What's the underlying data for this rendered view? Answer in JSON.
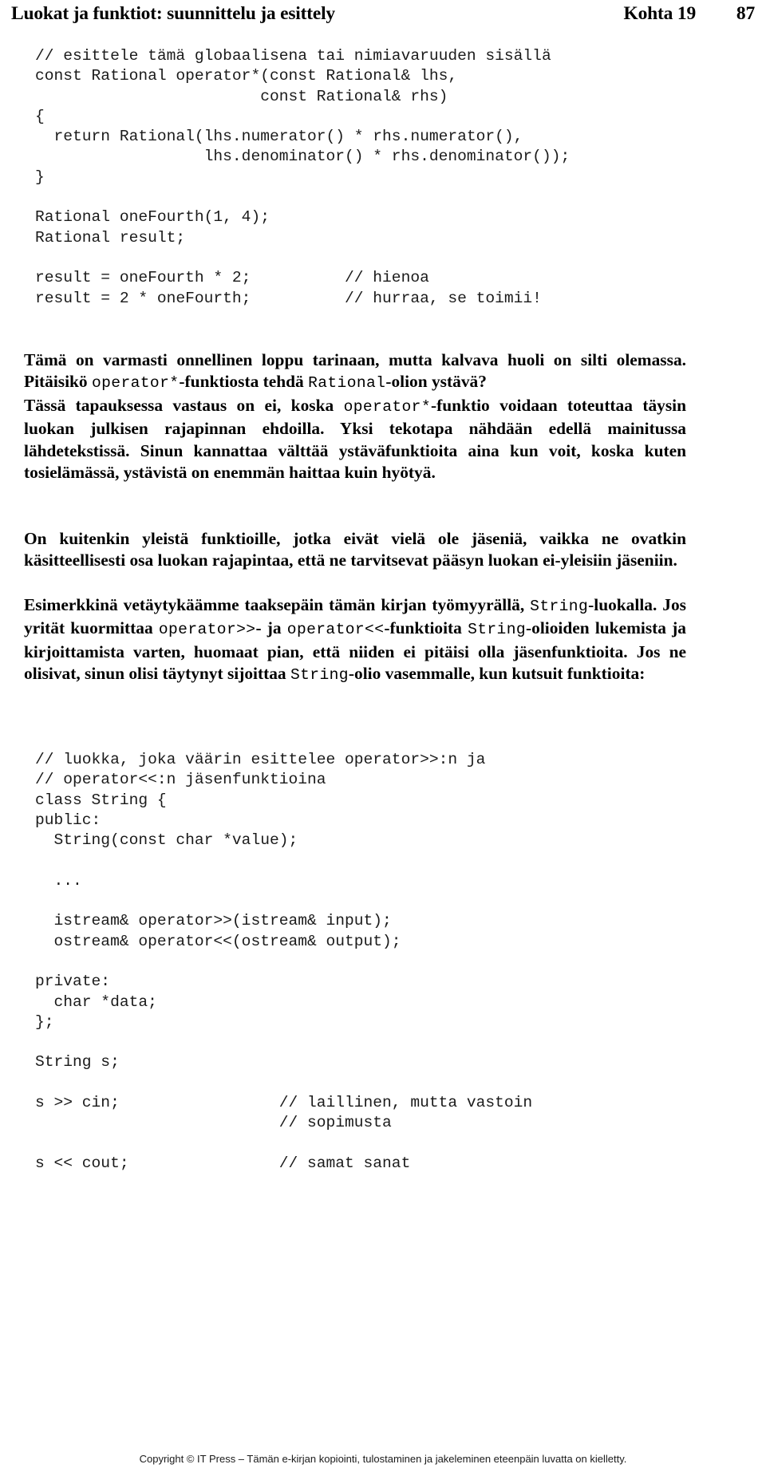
{
  "header": {
    "title": "Luokat ja funktiot: suunnittelu ja esittely",
    "section": "Kohta 19",
    "page_number": "87"
  },
  "code_block_1": {
    "lines": [
      "// esittele tämä globaalisena tai nimiavaruuden sisällä",
      "const Rational operator*(const Rational& lhs,",
      "                        const Rational& rhs)",
      "{",
      "  return Rational(lhs.numerator() * rhs.numerator(),",
      "                  lhs.denominator() * rhs.denominator());",
      "}",
      "",
      "Rational oneFourth(1, 4);",
      "Rational result;",
      "",
      "result = oneFourth * 2;          // hienoa",
      "result = 2 * oneFourth;          // hurraa, se toimii!"
    ]
  },
  "paragraphs": [
    {
      "id": "p1",
      "runs": [
        {
          "type": "text",
          "value": "Tämä on varmasti onnellinen loppu tarinaan, mutta kalvava huoli on silti olemassa. Pitäisikö "
        },
        {
          "type": "mono",
          "value": "operator*"
        },
        {
          "type": "text",
          "value": "-funktiosta tehdä "
        },
        {
          "type": "mono",
          "value": "Rational"
        },
        {
          "type": "text",
          "value": "-olion ystävä?"
        }
      ]
    },
    {
      "id": "p2",
      "runs": [
        {
          "type": "text",
          "value": "Tässä tapauksessa vastaus on ei, koska "
        },
        {
          "type": "mono",
          "value": "operator*"
        },
        {
          "type": "text",
          "value": "-funktio voidaan toteuttaa täysin luokan julkisen rajapinnan ehdoilla. Yksi tekotapa nähdään edellä mainitussa lähdetekstissä. Sinun kannattaa välttää ystäväfunktioita aina kun voit, koska kuten tosielämässä, ystävistä on enemmän haittaa kuin hyötyä."
        }
      ]
    },
    {
      "id": "p3",
      "runs": [
        {
          "type": "text",
          "value": "On kuitenkin yleistä funktioille, jotka eivät vielä ole jäseniä, vaikka ne ovatkin käsitteellisesti osa luokan rajapintaa, että ne tarvitsevat pääsyn luokan ei-yleisiin jäseniin."
        }
      ]
    },
    {
      "id": "p4",
      "runs": [
        {
          "type": "text",
          "value": "Esimerkkinä vetäytykäämme taaksepäin tämän kirjan työmyyrällä, "
        },
        {
          "type": "mono",
          "value": "String"
        },
        {
          "type": "text",
          "value": "-luokalla. Jos yrität kuormittaa "
        },
        {
          "type": "mono",
          "value": "operator>>"
        },
        {
          "type": "text",
          "value": "- ja "
        },
        {
          "type": "mono",
          "value": "operator<<"
        },
        {
          "type": "text",
          "value": "-funktioita "
        },
        {
          "type": "mono",
          "value": "String"
        },
        {
          "type": "text",
          "value": "-olioiden lukemista ja kirjoittamista varten, huomaat pian, että niiden ei pitäisi olla jäsenfunktioita. Jos ne olisivat, sinun olisi täytynyt sijoittaa "
        },
        {
          "type": "mono",
          "value": "String"
        },
        {
          "type": "text",
          "value": "-olio vasemmalle, kun kutsuit funktioita:"
        }
      ]
    }
  ],
  "code_block_2": {
    "lines": [
      "// luokka, joka väärin esittelee operator>>:n ja",
      "// operator<<:n jäsenfunktioina",
      "class String {",
      "public:",
      "  String(const char *value);",
      "",
      "  ...",
      "",
      "  istream& operator>>(istream& input);",
      "  ostream& operator<<(ostream& output);",
      "",
      "private:",
      "  char *data;",
      "};",
      "",
      "String s;",
      "",
      "s >> cin;                 // laillinen, mutta vastoin",
      "                          // sopimusta",
      "",
      "s << cout;                // samat sanat"
    ]
  },
  "footer": {
    "text": "Copyright © IT Press – Tämän e-kirjan kopiointi, tulostaminen ja jakeleminen eteenpäin luvatta on kielletty."
  }
}
